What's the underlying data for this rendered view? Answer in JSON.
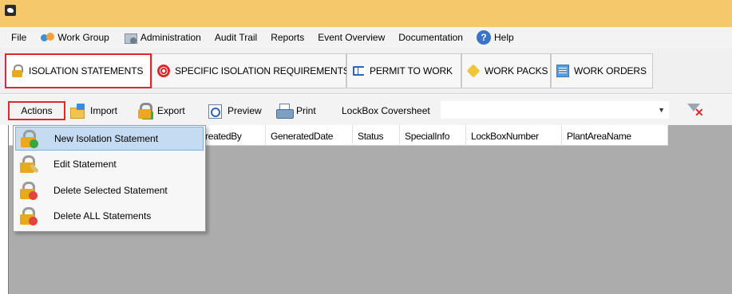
{
  "menu": {
    "items": [
      {
        "label": "File",
        "icon": ""
      },
      {
        "label": "Work Group",
        "icon": "work-group-icon"
      },
      {
        "label": "Administration",
        "icon": "administration-icon"
      },
      {
        "label": "Audit Trail",
        "icon": ""
      },
      {
        "label": "Reports",
        "icon": ""
      },
      {
        "label": "Event Overview",
        "icon": ""
      },
      {
        "label": "Documentation",
        "icon": ""
      },
      {
        "label": "Help",
        "icon": "help-icon"
      }
    ]
  },
  "tabs": [
    {
      "label": "ISOLATION STATEMENTS",
      "icon": "lock-icon",
      "active": true
    },
    {
      "label": "SPECIFIC ISOLATION REQUIREMENTS",
      "icon": "target-icon",
      "active": false
    },
    {
      "label": "PERMIT TO WORK",
      "icon": "book-icon",
      "active": false
    },
    {
      "label": "WORK PACKS",
      "icon": "package-icon",
      "active": false
    },
    {
      "label": "WORK ORDERS",
      "icon": "orders-icon",
      "active": false
    }
  ],
  "toolbar": {
    "actions": "Actions",
    "import": "Import",
    "export": "Export",
    "preview": "Preview",
    "print": "Print",
    "lockbox_label": "LockBox Coversheet",
    "lockbox_value": ""
  },
  "grid": {
    "columns": [
      "reatedBy",
      "GeneratedDate",
      "Status",
      "SpecialInfo",
      "LockBoxNumber",
      "PlantAreaName"
    ]
  },
  "actions_menu": {
    "items": [
      {
        "label": "New Isolation Statement",
        "badge": "add",
        "highlighted": true
      },
      {
        "label": "Edit Statement",
        "badge": "edit",
        "highlighted": false
      },
      {
        "label": "Delete Selected Statement",
        "badge": "delete",
        "highlighted": false
      },
      {
        "label": "Delete ALL Statements",
        "badge": "delete",
        "highlighted": false
      }
    ]
  },
  "colors": {
    "title_bar": "#f5c86b",
    "highlight_border": "#e0272b",
    "menu_hover": "#c5dbf2",
    "grid_background": "#acacac"
  }
}
